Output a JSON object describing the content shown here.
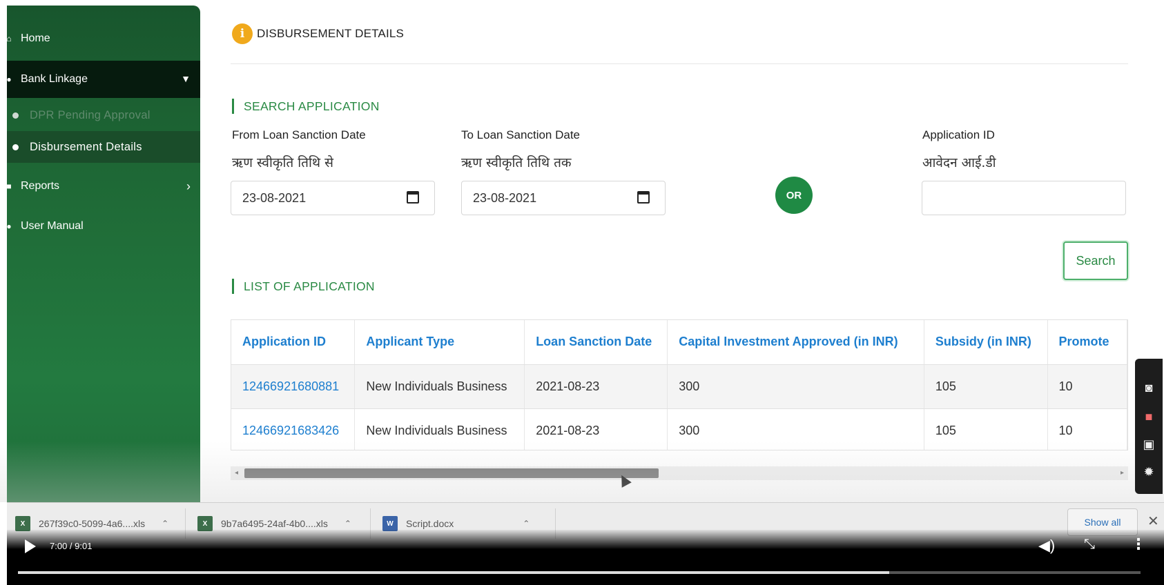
{
  "sidebar": {
    "home_label": "Home",
    "bank_linkage_label": "Bank Linkage",
    "dpr_pending_label": "DPR Pending Approval",
    "disbursement_label": "Disbursement Details",
    "reports_label": "Reports",
    "user_manual_label": "User Manual"
  },
  "header": {
    "title": "DISBURSEMENT DETAILS"
  },
  "search": {
    "section_title": "SEARCH APPLICATION",
    "from_label": "From Loan Sanction Date",
    "from_label_hindi": "ऋण स्वीकृति तिथि से",
    "from_value": "23-08-2021",
    "to_label": "To Loan Sanction Date",
    "to_label_hindi": "ऋण स्वीकृति तिथि तक",
    "to_value": "23-08-2021",
    "or_label": "OR",
    "app_id_label": "Application ID",
    "app_id_label_hindi": "आवेदन आई.डी",
    "app_id_value": "",
    "search_button": "Search"
  },
  "list": {
    "section_title": "LIST OF APPLICATION",
    "columns": [
      "Application ID",
      "Applicant Type",
      "Loan Sanction Date",
      "Capital Investment Approved (in INR)",
      "Subsidy (in INR)",
      "Promote"
    ],
    "rows": [
      {
        "app_id": "12466921680881",
        "type": "New Individuals Business",
        "date": "2021-08-23",
        "capital": "300",
        "subsidy": "105",
        "promoter": "10"
      },
      {
        "app_id": "12466921683426",
        "type": "New Individuals Business",
        "date": "2021-08-23",
        "capital": "300",
        "subsidy": "105",
        "promoter": "10"
      }
    ]
  },
  "downloads": {
    "file1": "267f39c0-5099-4a6....xls",
    "file2": "9b7a6495-24af-4b0....xls",
    "file3": "Script.docx",
    "show_all": "Show all"
  },
  "video": {
    "time": "7:00 / 9:01",
    "progress": 0.776
  },
  "colors": {
    "sidebar_green": "#1f6b37",
    "accent_green": "#2a8a44",
    "link_blue": "#1e7fcf",
    "info_orange": "#f0a91c"
  }
}
